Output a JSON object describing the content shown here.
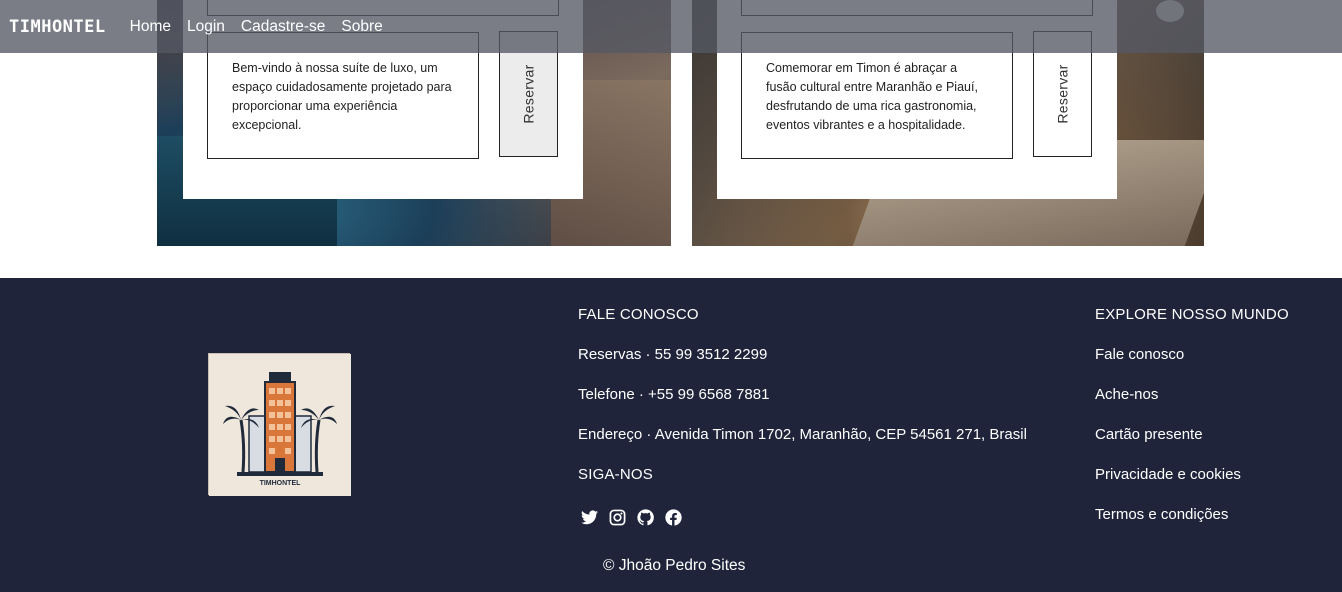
{
  "navbar": {
    "brand": "TIMHONTEL",
    "links": [
      "Home",
      "Login",
      "Cadastre-se",
      "Sobre"
    ]
  },
  "cards": [
    {
      "text": "Bem-vindo à nossa suíte de luxo, um espaço cuidadosamente projetado para proporcionar uma experiência excepcional.",
      "button": "Reservar"
    },
    {
      "text": "Comemorar em Timon é abraçar a fusão cultural entre Maranhão e Piauí, desfrutando de uma rica gastronomia, eventos vibrantes e a hospitalidade.",
      "button": "Reservar"
    }
  ],
  "footer": {
    "logo_text": "TIMHONTEL",
    "contact": {
      "heading": "FALE CONOSCO",
      "lines": [
        "Reservas · 55 99 3512 2299",
        "Telefone · +55 99 6568 7881",
        "Endereço · Avenida Timon 1702, Maranhão, CEP 54561 271, Brasil"
      ]
    },
    "follow": {
      "heading": "SIGA-NOS",
      "icons": [
        "twitter-icon",
        "instagram-icon",
        "github-icon",
        "facebook-icon"
      ]
    },
    "explore": {
      "heading": "EXPLORE NOSSO MUNDO",
      "links": [
        "Fale conosco",
        "Ache-nos",
        "Cartão presente",
        "Privacidade e cookies",
        "Termos e condições"
      ]
    },
    "copyright": "© Jhoão Pedro Sites"
  },
  "colors": {
    "footer_bg": "#1f243a",
    "navbar_bg": "rgba(85,88,100,0.78)"
  }
}
